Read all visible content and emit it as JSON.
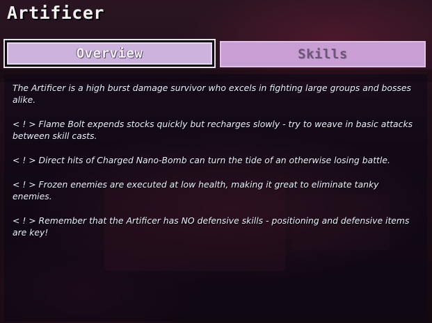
{
  "header": {
    "title": "Artificer"
  },
  "tabs": [
    {
      "label": "Overview",
      "selected": true
    },
    {
      "label": "Skills",
      "selected": false
    }
  ],
  "overview": {
    "paragraphs": [
      "The Artificer is a high burst damage survivor who excels in fighting large groups and bosses alike.",
      "< ! > Flame Bolt expends stocks quickly but recharges slowly - try to weave in basic attacks between skill casts.",
      "< ! > Direct hits of Charged Nano-Bomb can turn the tide of an otherwise losing battle.",
      "< ! > Frozen enemies are executed at low health, making it great to eliminate tanky enemies.",
      "< ! > Remember that the Artificer has NO defensive skills - positioning and defensive items are key!"
    ]
  },
  "colors": {
    "tab_selected": "#ccb2dd",
    "tab_unselected": "#c99ed4",
    "text": "#eef0ff"
  }
}
